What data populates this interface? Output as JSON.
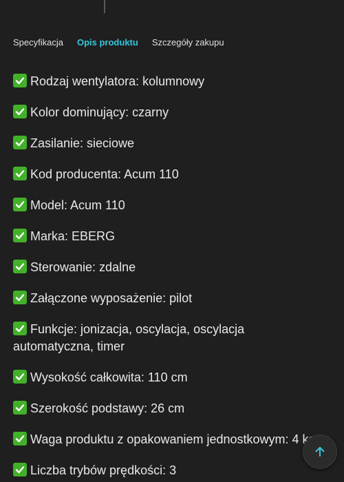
{
  "tabs": [
    {
      "label": "Specyfikacja",
      "active": false
    },
    {
      "label": "Opis produktu",
      "active": true
    },
    {
      "label": "Szczegóły zakupu",
      "active": false
    }
  ],
  "colors": {
    "accent": "#35c8dc",
    "check_green": "#43b02a",
    "background": "#1f1f1f"
  },
  "check_icon": "white-heavy-check-mark-icon",
  "features": [
    "Rodzaj wentylatora: kolumnowy",
    "Kolor dominujący: czarny",
    "Zasilanie: sieciowe",
    "Kod producenta: Acum 110",
    "Model: Acum 110",
    "Marka: EBERG",
    "Sterowanie: zdalne",
    "Załączone wyposażenie: pilot",
    "Funkcje: jonizacja, oscylacja, oscylacja automatyczna, timer",
    "Wysokość całkowita: 110 cm",
    "Szerokość podstawy: 26 cm",
    "Waga produktu z opakowaniem jednostkowym: 4 kg",
    "Liczba trybów prędkości: 3"
  ],
  "scroll_top_icon": "arrow-up-icon"
}
